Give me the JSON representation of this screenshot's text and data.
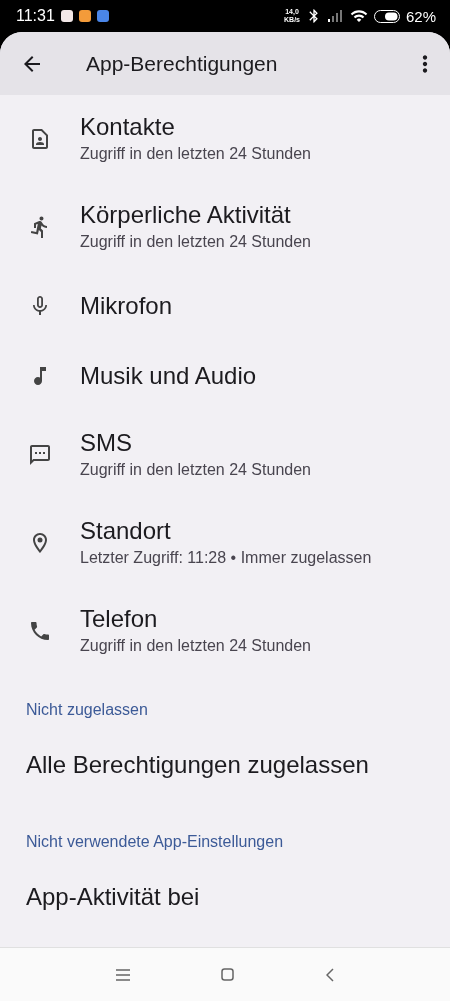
{
  "status_bar": {
    "time": "11:31",
    "net_speed": "14,0",
    "net_unit": "KB/s",
    "battery": "62%"
  },
  "header": {
    "title": "App-Berechtigungen"
  },
  "allowed": [
    {
      "title": "Kontakte",
      "subtitle": "Zugriff in den letzten 24 Stunden"
    },
    {
      "title": "Körperliche Aktivität",
      "subtitle": "Zugriff in den letzten 24 Stunden"
    },
    {
      "title": "Mikrofon"
    },
    {
      "title": "Musik und Audio"
    },
    {
      "title": "SMS",
      "subtitle": "Zugriff in den letzten 24 Stunden"
    },
    {
      "title": "Standort",
      "subtitle": "Letzter Zugriff: 11:28 • Immer zugelassen"
    },
    {
      "title": "Telefon",
      "subtitle": "Zugriff in den letzten 24 Stunden"
    }
  ],
  "denied": {
    "heading": "Nicht zugelassen",
    "items": [
      {
        "title": "Alle Berechtigungen zugelassen"
      }
    ]
  },
  "unused": {
    "heading": "Nicht verwendete App-Einstellungen",
    "items": [
      {
        "title": "App-Aktivität bei"
      }
    ]
  }
}
